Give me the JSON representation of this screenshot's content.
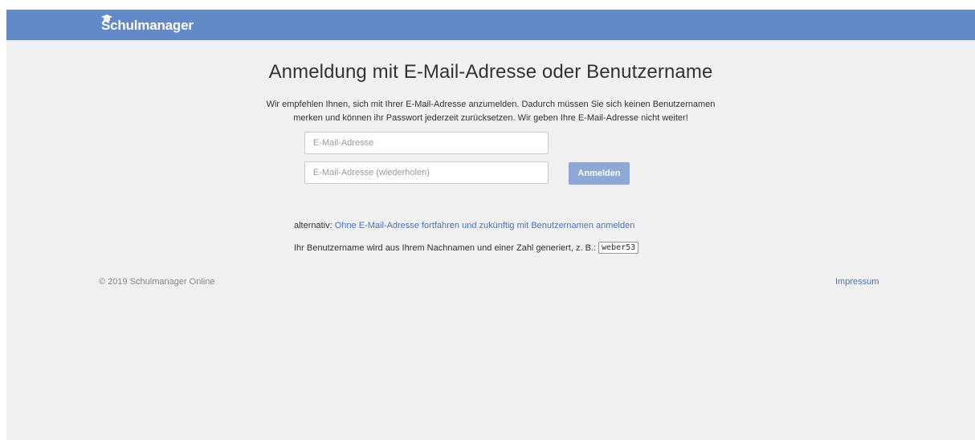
{
  "header": {
    "brand": "Schulmanager",
    "brand_icon": "graduation-cap-icon",
    "brand_color": "#6389c6"
  },
  "main": {
    "title": "Anmeldung mit E-Mail-Adresse oder Benutzername",
    "intro_line1": "Wir empfehlen Ihnen, sich mit Ihrer E-Mail-Adresse anzumelden. Dadurch müssen Sie sich keinen Benutzernamen",
    "intro_line2": "merken und können ihr Passwort jederzeit zurücksetzen. Wir geben Ihre E-Mail-Adresse nicht weiter!",
    "email_placeholder": "E-Mail-Adresse",
    "email_value": "",
    "email_repeat_placeholder": "E-Mail-Adresse (wiederholen)",
    "email_repeat_value": "",
    "login_button": "Anmelden",
    "alt_prefix": "alternativ:",
    "alt_link": "Ohne E-Mail-Adresse fortfahren und zukünftig mit Benutzernamen anmelden",
    "username_hint": "Ihr Benutzername wird aus Ihrem Nachnamen und einer Zahl generiert, z. B.:",
    "username_example": "weber53"
  },
  "footer": {
    "copyright": "© 2019 Schulmanager Online",
    "impressum": "Impressum"
  }
}
